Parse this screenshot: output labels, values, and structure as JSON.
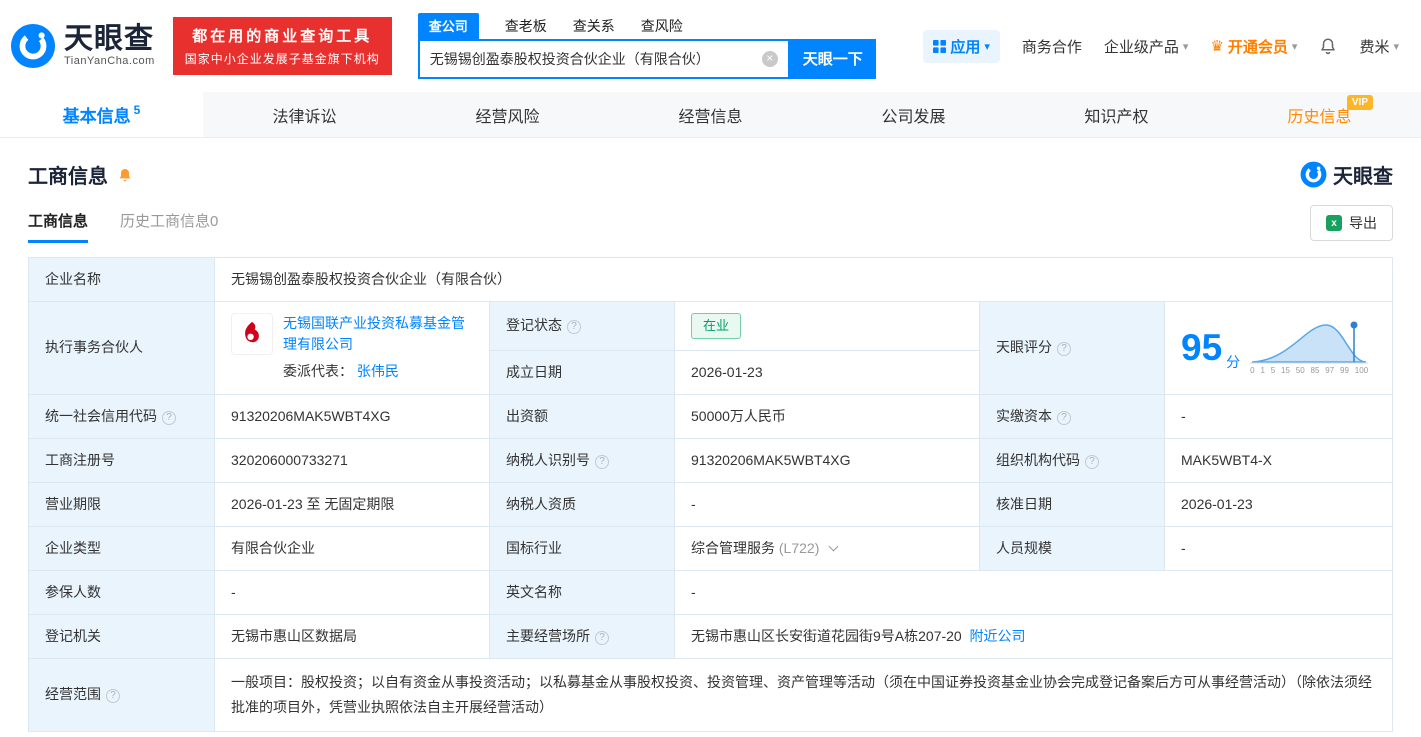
{
  "brand": {
    "name": "天眼查",
    "domain": "TianYanCha.com"
  },
  "banner": {
    "line1": "都在用的商业查询工具",
    "line2": "国家中小企业发展子基金旗下机构"
  },
  "search": {
    "tabs": [
      {
        "label": "查公司"
      },
      {
        "label": "查老板"
      },
      {
        "label": "查关系"
      },
      {
        "label": "查风险"
      }
    ],
    "value": "无锡锡创盈泰股权投资合伙企业（有限合伙）",
    "button": "天眼一下"
  },
  "topnav": {
    "apps": "应用",
    "cooperation": "商务合作",
    "enterprise": "企业级产品",
    "vip": "开通会员",
    "user": "费米"
  },
  "tabs": [
    {
      "label": "基本信息",
      "count": "5"
    },
    {
      "label": "法律诉讼"
    },
    {
      "label": "经营风险"
    },
    {
      "label": "经营信息"
    },
    {
      "label": "公司发展"
    },
    {
      "label": "知识产权"
    },
    {
      "label": "历史信息",
      "vip": "VIP"
    }
  ],
  "section": {
    "title": "工商信息",
    "brand": "天眼查",
    "subtab_active": "工商信息",
    "subtab_history": "历史工商信息0",
    "export": "导出"
  },
  "info": {
    "company_name_label": "企业名称",
    "company_name": "无锡锡创盈泰股权投资合伙企业（有限合伙）",
    "partner_label": "执行事务合伙人",
    "partner_name": "无锡国联产业投资私募基金管理有限公司",
    "partner_rep_label": "委派代表：",
    "partner_rep_name": "张伟民",
    "reg_status_label": "登记状态",
    "reg_status": "在业",
    "establish_label": "成立日期",
    "establish_date": "2026-01-23",
    "score_label": "天眼评分",
    "score_value": "95",
    "score_unit": "分",
    "score_axis": [
      "0",
      "1",
      "5",
      "15",
      "50",
      "85",
      "97",
      "99",
      "100"
    ],
    "credit_code_label": "统一社会信用代码",
    "credit_code": "91320206MAK5WBT4XG",
    "capital_label": "出资额",
    "capital": "50000万人民币",
    "paid_capital_label": "实缴资本",
    "paid_capital": "-",
    "reg_number_label": "工商注册号",
    "reg_number": "320206000733271",
    "taxpayer_id_label": "纳税人识别号",
    "taxpayer_id": "91320206MAK5WBT4XG",
    "org_code_label": "组织机构代码",
    "org_code": "MAK5WBT4-X",
    "term_label": "营业期限",
    "term": "2026-01-23 至 无固定期限",
    "taxpayer_quality_label": "纳税人资质",
    "taxpayer_quality": "-",
    "approve_date_label": "核准日期",
    "approve_date": "2026-01-23",
    "company_type_label": "企业类型",
    "company_type": "有限合伙企业",
    "industry_label": "国标行业",
    "industry": "综合管理服务",
    "industry_code": "(L722)",
    "staff_size_label": "人员规模",
    "staff_size": "-",
    "insured_label": "参保人数",
    "insured": "-",
    "english_name_label": "英文名称",
    "english_name": "-",
    "reg_authority_label": "登记机关",
    "reg_authority": "无锡市惠山区数据局",
    "address_label": "主要经营场所",
    "address": "无锡市惠山区长安街道花园街9号A栋207-20",
    "nearby_link": "附近公司",
    "business_scope_label": "经营范围",
    "business_scope": "一般项目：股权投资；以自有资金从事投资活动；以私募基金从事股权投资、投资管理、资产管理等活动（须在中国证券投资基金业协会完成登记备案后方可从事经营活动）（除依法须经批准的项目外，凭营业执照依法自主开展经营活动）"
  },
  "colors": {
    "primary": "#0084ff",
    "banner_red": "#e8312f",
    "vip_orange": "#ff8000",
    "history_orange": "#ff8a00",
    "status_green": "#00a06a",
    "label_bg": "#e9f4fd"
  }
}
